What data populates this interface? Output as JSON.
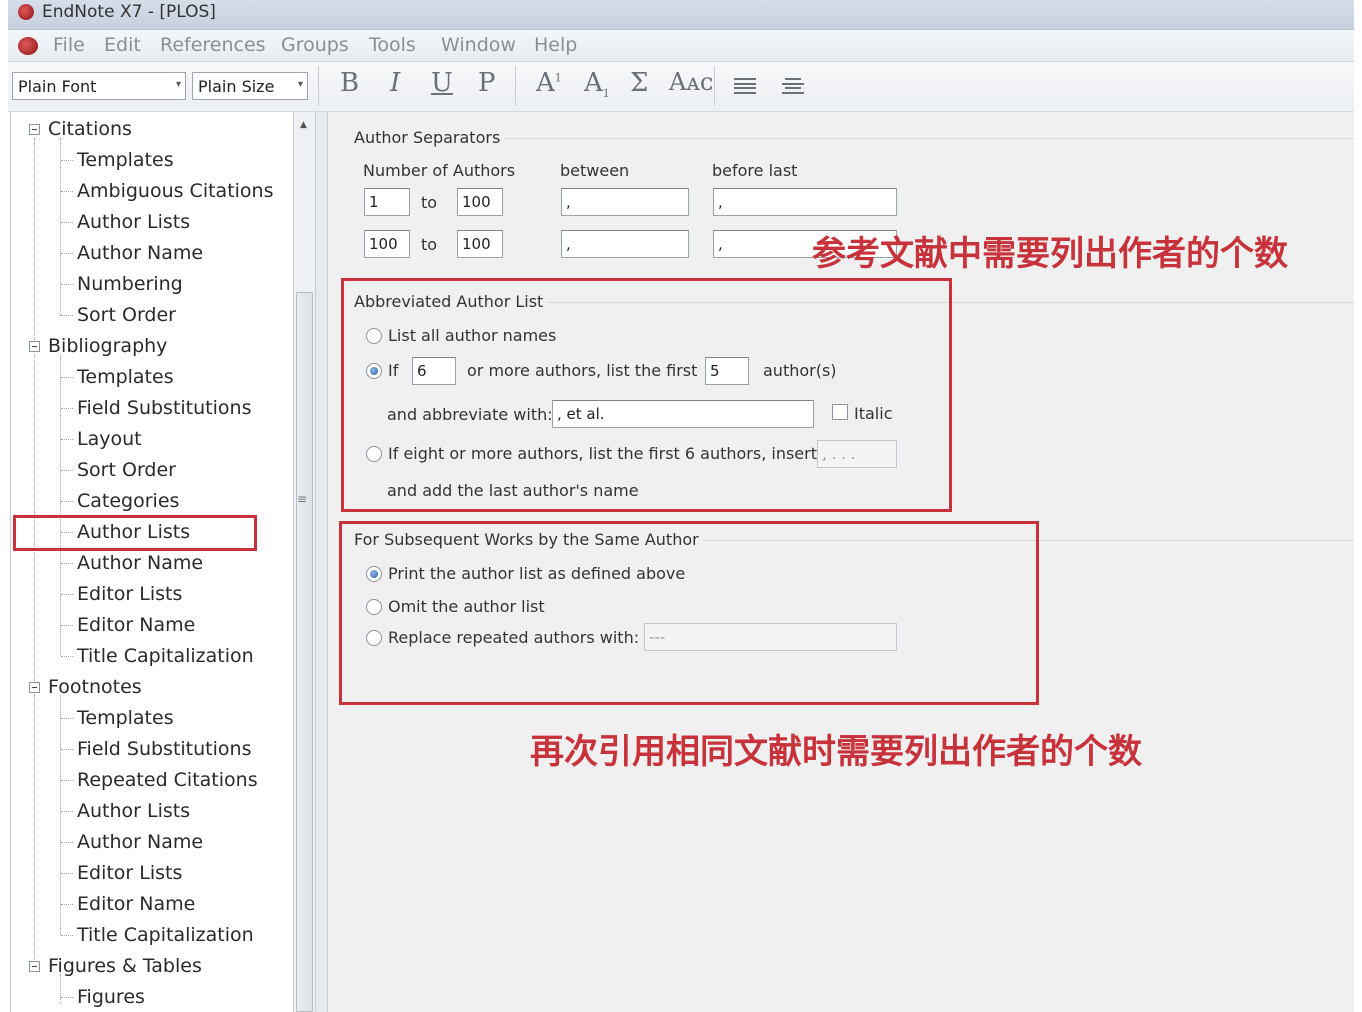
{
  "window": {
    "title": "EndNote X7 - [PLOS]"
  },
  "menu": {
    "items": [
      "File",
      "Edit",
      "References",
      "Groups",
      "Tools",
      "Window",
      "Help"
    ]
  },
  "toolbar": {
    "font_select": "Plain Font",
    "size_select": "Plain Size",
    "bold": "B",
    "italic": "I",
    "underline": "U",
    "plain": "P",
    "superscript": "A",
    "superscript_mark": "1",
    "subscript": "A",
    "subscript_mark": "1",
    "symbol": "Σ",
    "small_caps": "Aᴀᴄ"
  },
  "tree": {
    "groups": [
      {
        "label": "Citations",
        "children": [
          "Templates",
          "Ambiguous Citations",
          "Author Lists",
          "Author Name",
          "Numbering",
          "Sort Order"
        ]
      },
      {
        "label": "Bibliography",
        "children": [
          "Templates",
          "Field Substitutions",
          "Layout",
          "Sort Order",
          "Categories",
          "Author Lists",
          "Author Name",
          "Editor Lists",
          "Editor Name",
          "Title Capitalization"
        ]
      },
      {
        "label": "Footnotes",
        "children": [
          "Templates",
          "Field Substitutions",
          "Repeated Citations",
          "Author Lists",
          "Author Name",
          "Editor Lists",
          "Editor Name",
          "Title Capitalization"
        ]
      },
      {
        "label": "Figures & Tables",
        "children": [
          "Figures"
        ]
      }
    ],
    "selected": "Bibliography / Author Lists"
  },
  "author_separators": {
    "title": "Author Separators",
    "col_number": "Number of Authors",
    "col_between": "between",
    "col_before_last": "before last",
    "to_label": "to",
    "row1": {
      "from": "1",
      "to": "100",
      "between": ",",
      "before_last": ","
    },
    "row2": {
      "from": "100",
      "to": "100",
      "between": ",",
      "before_last": ","
    }
  },
  "abbreviated": {
    "title": "Abbreviated Author List",
    "opt_list_all": "List all author names",
    "opt_if": "If",
    "if_count": "6",
    "or_more_text": "or more authors, list the first",
    "list_first": "5",
    "authors_suffix": "author(s)",
    "abbrev_label": "and abbreviate with:",
    "abbrev_value": ", et al.",
    "italic_label": "Italic",
    "opt_eight": "If eight or more authors, list the first 6 authors, insert:",
    "eight_insert": ", . . .",
    "add_last": "and add the last author's name"
  },
  "subsequent": {
    "title": "For Subsequent Works by the Same Author",
    "opt_print": "Print the author list as defined above",
    "opt_omit": "Omit the author list",
    "opt_replace": "Replace repeated authors with:",
    "replace_value": "---"
  },
  "annotations": {
    "top": "参考文献中需要列出作者的个数",
    "bottom": "再次引用相同文献时需要列出作者的个数"
  },
  "colors": {
    "annotation_red": "#c8323a",
    "panel_bg": "#f0f0f0"
  }
}
